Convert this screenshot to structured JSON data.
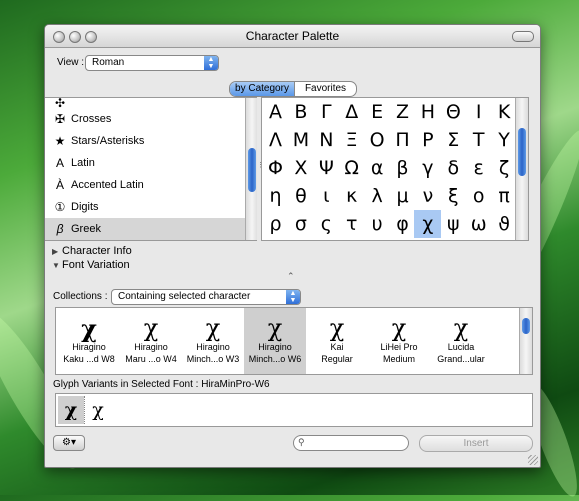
{
  "window": {
    "title": "Character Palette"
  },
  "view": {
    "label": "View :",
    "value": "Roman"
  },
  "tabs": [
    {
      "label": "by Category",
      "selected": true
    },
    {
      "label": "Favorites",
      "selected": false
    }
  ],
  "categories": [
    {
      "icon": "✠",
      "label": "Crosses"
    },
    {
      "icon": "★",
      "label": "Stars/Asterisks"
    },
    {
      "icon": "A",
      "label": "Latin"
    },
    {
      "icon": "À",
      "label": "Accented Latin"
    },
    {
      "icon": "①",
      "label": "Digits"
    },
    {
      "icon": "β",
      "label": "Greek",
      "selected": true
    }
  ],
  "characters": [
    [
      "Α",
      "Β",
      "Γ",
      "Δ",
      "Ε",
      "Ζ",
      "Η",
      "Θ",
      "Ι",
      "Κ"
    ],
    [
      "Λ",
      "Μ",
      "Ν",
      "Ξ",
      "Ο",
      "Π",
      "Ρ",
      "Σ",
      "Τ",
      "Υ"
    ],
    [
      "Φ",
      "Χ",
      "Ψ",
      "Ω",
      "α",
      "β",
      "γ",
      "δ",
      "ε",
      "ζ"
    ],
    [
      "η",
      "θ",
      "ι",
      "κ",
      "λ",
      "μ",
      "ν",
      "ξ",
      "ο",
      "π"
    ],
    [
      "ρ",
      "σ",
      "ς",
      "τ",
      "υ",
      "φ",
      "χ",
      "ψ",
      "ω",
      "ϑ"
    ]
  ],
  "selected_character": "χ",
  "sections": {
    "character_info": "Character Info",
    "font_variation": "Font Variation"
  },
  "collections": {
    "label": "Collections :",
    "value": "Containing selected character"
  },
  "fonts": [
    {
      "glyph": "χ",
      "name1": "Hiragino",
      "name2": "Kaku ...d W8"
    },
    {
      "glyph": "χ",
      "name1": "Hiragino",
      "name2": "Maru ...o W4"
    },
    {
      "glyph": "χ",
      "name1": "Hiragino",
      "name2": "Minch...o W3"
    },
    {
      "glyph": "χ",
      "name1": "Hiragino",
      "name2": "Minch...o W6",
      "selected": true
    },
    {
      "glyph": "χ",
      "name1": "Kai",
      "name2": "Regular"
    },
    {
      "glyph": "χ",
      "name1": "LiHei Pro",
      "name2": "Medium"
    },
    {
      "glyph": "χ",
      "name1": "Lucida",
      "name2": "Grand...ular"
    }
  ],
  "glyph_variants": {
    "label": "Glyph Variants in Selected Font : HiraMinPro-W6",
    "glyphs": [
      "χ",
      "χ"
    ]
  },
  "search": {
    "placeholder": ""
  },
  "insert_label": "Insert",
  "icons": {
    "gear": "gear-icon",
    "search": "search-icon",
    "disclosure": "disclosure-triangle-icon"
  }
}
